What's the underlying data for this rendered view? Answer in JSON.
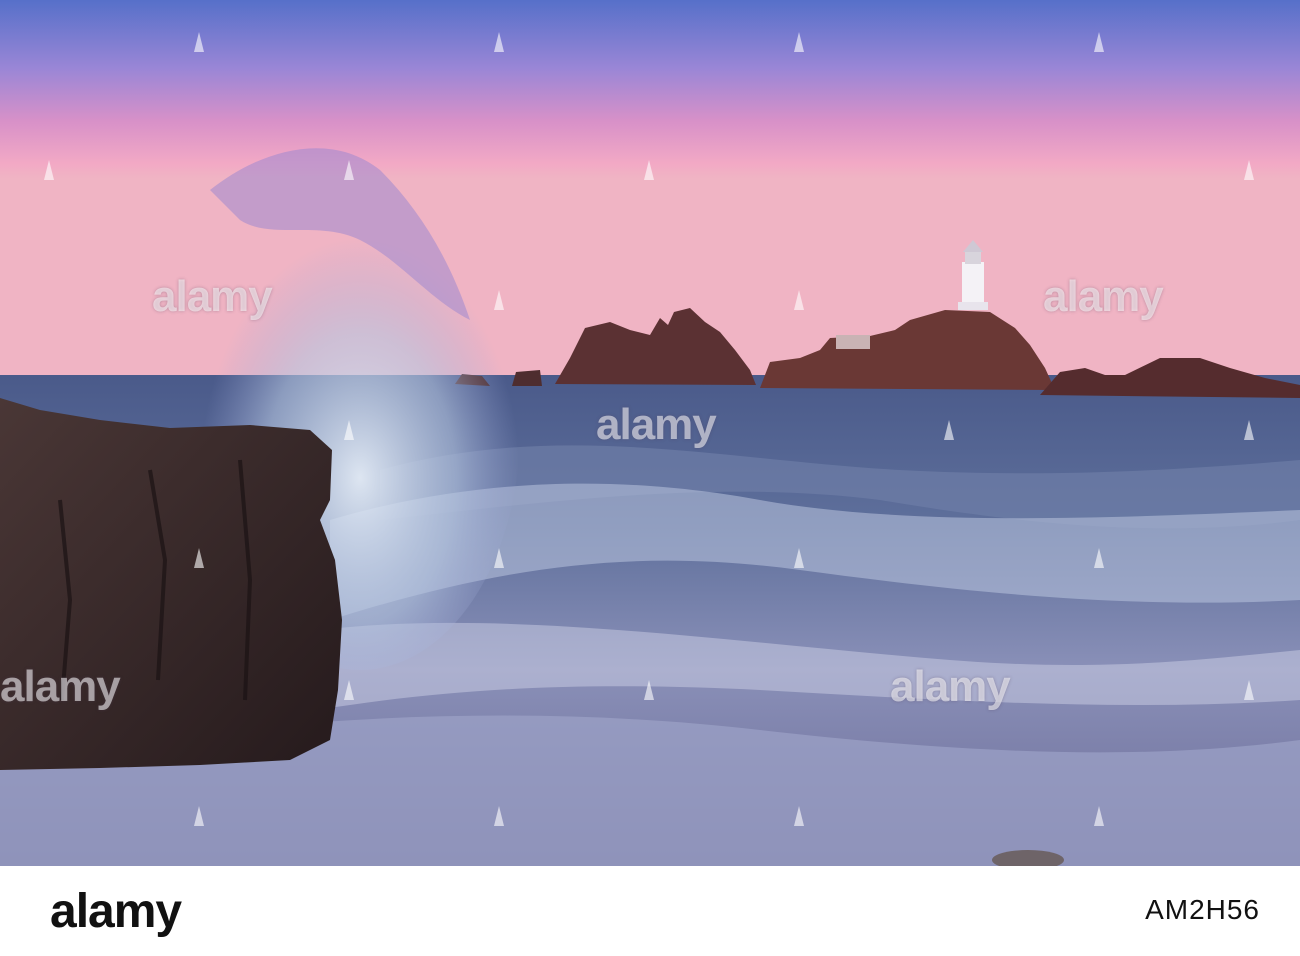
{
  "photo": {
    "subject": "",
    "colors": {
      "sky_top": "#5a6fc8",
      "sky_mid": "#d98fc6",
      "sky_low": "#f4b0c4",
      "sea": "#5a6e9c",
      "rock": "#3a2a2a",
      "lighthouse": "#ffffff"
    }
  },
  "watermark": {
    "word": "alamy",
    "rows": [
      {
        "count": 4
      },
      {
        "count": 4
      },
      {
        "count": 4
      },
      {
        "count": 4
      }
    ]
  },
  "footer": {
    "brand": "alamy",
    "image_id": "AM2H56"
  }
}
